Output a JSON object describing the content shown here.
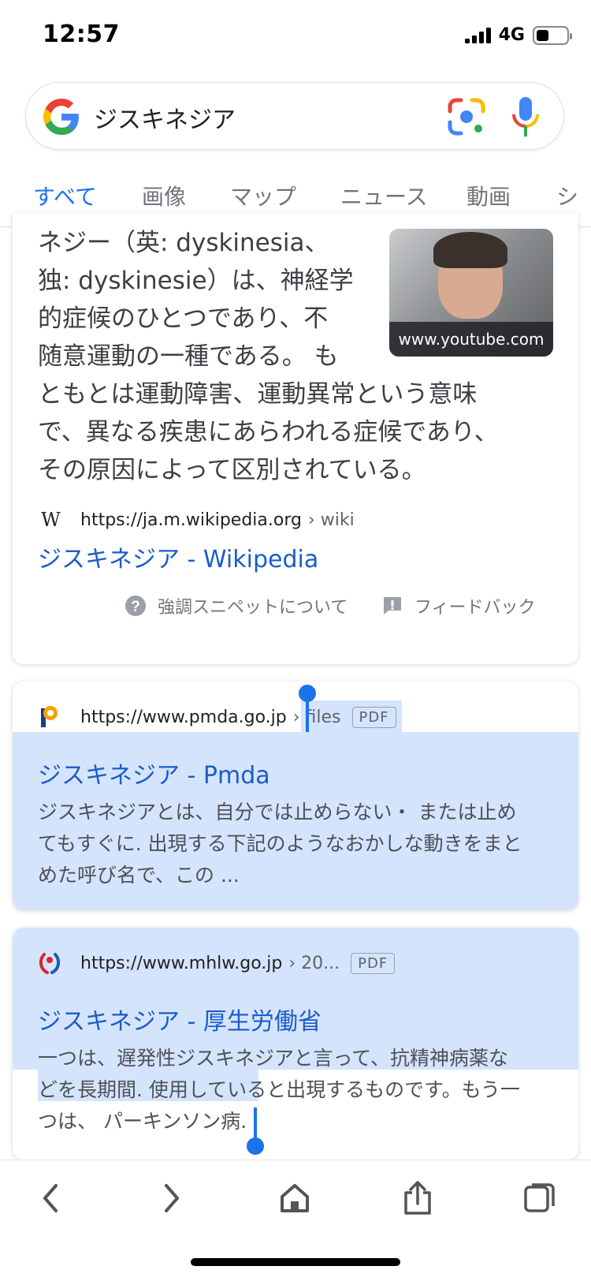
{
  "status_bar": {
    "time": "12:57",
    "network": "4G",
    "battery_level": 0.42
  },
  "search": {
    "query": "ジスキネジア"
  },
  "tabs": [
    {
      "label": "すべて",
      "active": true
    },
    {
      "label": "画像",
      "active": false
    },
    {
      "label": "マップ",
      "active": false
    },
    {
      "label": "ニュース",
      "active": false
    },
    {
      "label": "動画",
      "active": false
    },
    {
      "label": "シ",
      "active": false
    }
  ],
  "featured_snippet": {
    "line1": "ネジー（英: dyskinesia、",
    "line2": "独: dyskinesie）は、神経学",
    "line3": "的症候のひとつであり、不",
    "line4": "随意運動の一種である。 も",
    "line5": "ともとは運動障害、運動異常という意味",
    "line6": "で、異なる疾患にあらわれる症候であり、",
    "line7": "その原因によって区別されている。",
    "thumbnail_caption": "www.youtube.com",
    "source_url": "https://ja.m.wikipedia.org",
    "source_path": "› wiki",
    "title": "ジスキネジア - Wikipedia",
    "about_label": "強調スニペットについて",
    "feedback_label": "フィードバック"
  },
  "results": [
    {
      "url": "https://www.pmda.go.jp",
      "path": "› files",
      "badge": "PDF",
      "title": "ジスキネジア - Pmda",
      "desc1": "ジスキネジアとは、自分では止めらない・ または止め",
      "desc2": "てもすぐに. 出現する下記のようなおかしな動きをまと",
      "desc3": "めた呼び名で、この ..."
    },
    {
      "url": "https://www.mhlw.go.jp",
      "path": "› 20...",
      "badge": "PDF",
      "title": "ジスキネジア - 厚生労働省",
      "desc1": "一つは、遅発性ジスキネジアと言って、抗精神病薬な",
      "desc2": "どを長期間. 使用していると出現するものです。もう一",
      "desc3": "つは、 パーキンソン病."
    }
  ],
  "toolbar": [
    "back-icon",
    "forward-icon",
    "home-icon",
    "share-icon",
    "tabs-icon"
  ]
}
